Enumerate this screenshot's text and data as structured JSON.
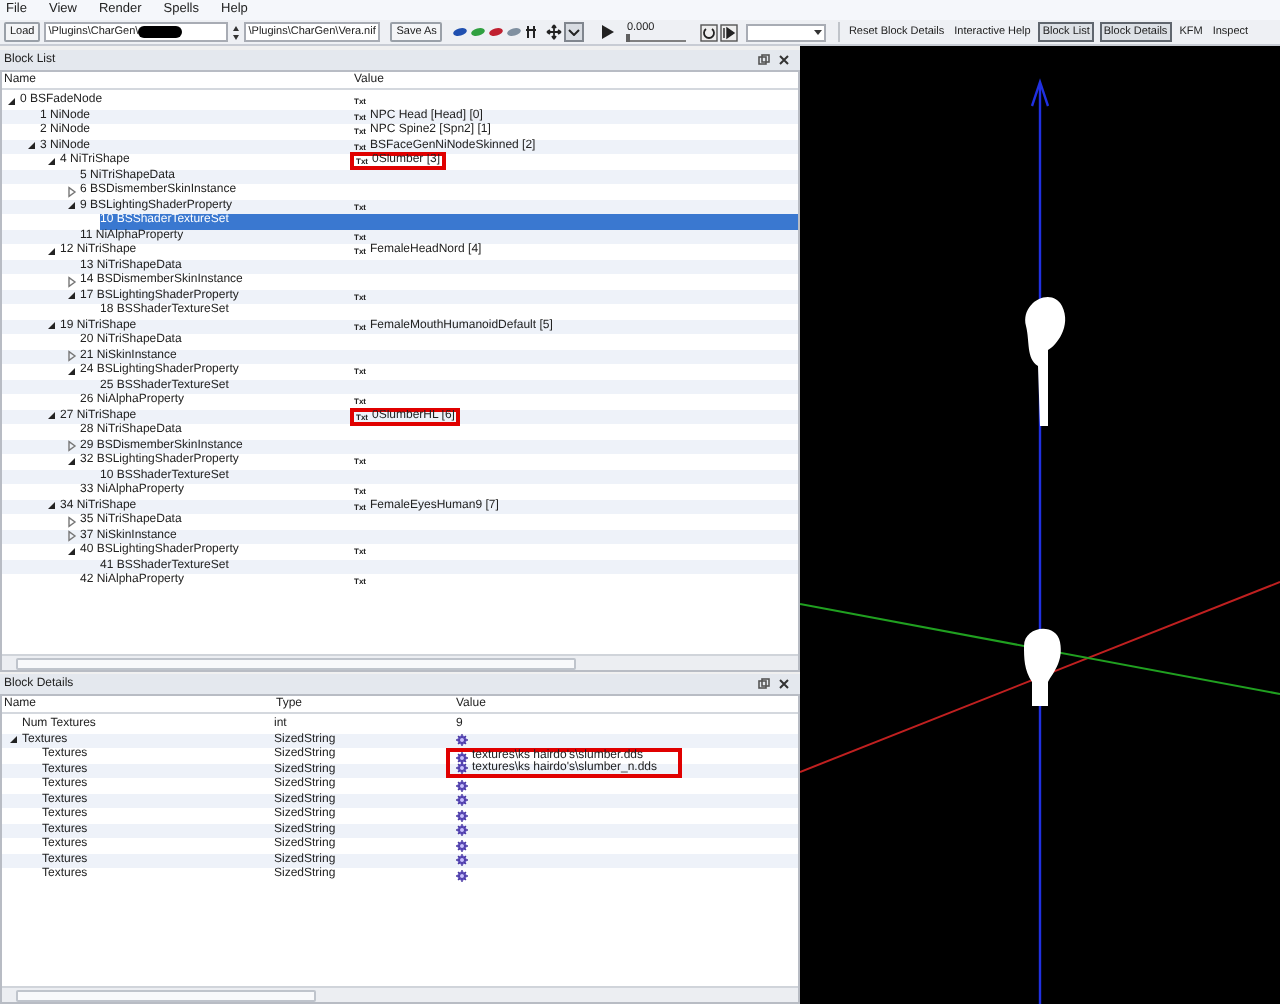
{
  "menu": [
    "File",
    "View",
    "Render",
    "Spells",
    "Help"
  ],
  "toolbar": {
    "load_button": "Load",
    "path_field": {
      "value": "\\Plugins\\CharGen\\",
      "redacted": true
    },
    "file_field": {
      "value": "\\Plugins\\CharGen\\Vera.nif"
    },
    "save_button": "Save As",
    "time": {
      "reading": "0.000",
      "level": 0
    },
    "buttons": [
      {
        "label": "Reset Block Details",
        "pressed": false
      },
      {
        "label": "Interactive Help",
        "pressed": false
      },
      {
        "label": "Block List",
        "pressed": true
      },
      {
        "label": "Block Details",
        "pressed": true
      },
      {
        "label": "KFM",
        "pressed": false
      },
      {
        "label": "Inspect",
        "pressed": false
      }
    ]
  },
  "block_list": {
    "title": "Block List",
    "columns": [
      "Name",
      "Value"
    ],
    "rows": [
      {
        "label": "0 BSFadeNode",
        "tag": "Txt",
        "expanded": true,
        "selected": false,
        "highlighted": false,
        "children": [
          {
            "label": "1 NiNode",
            "tag": "Txt",
            "value": "NPC Head [Head] [0]",
            "selected": false,
            "highlighted": false
          },
          {
            "label": "2 NiNode",
            "tag": "Txt",
            "value": "NPC Spine2 [Spn2] [1]",
            "selected": false,
            "highlighted": false
          },
          {
            "label": "3 NiNode",
            "tag": "Txt",
            "value": "BSFaceGenNiNodeSkinned [2]",
            "expanded": true,
            "selected": false,
            "highlighted": false,
            "children": [
              {
                "label": "4 NiTriShape",
                "tag": "Txt",
                "value": "0Slumber [3]",
                "expanded": true,
                "selected": false,
                "highlighted": true,
                "children": [
                  {
                    "label": "5 NiTriShapeData",
                    "selected": false,
                    "highlighted": false
                  },
                  {
                    "label": "6 BSDismemberSkinInstance",
                    "expanded": false,
                    "selected": false,
                    "highlighted": false
                  },
                  {
                    "label": "9 BSLightingShaderProperty",
                    "tag": "Txt",
                    "expanded": true,
                    "selected": false,
                    "highlighted": false,
                    "children": [
                      {
                        "label": "10 BSShaderTextureSet",
                        "selected": true,
                        "highlighted": false
                      }
                    ]
                  },
                  {
                    "label": "11 NiAlphaProperty",
                    "tag": "Txt",
                    "selected": false,
                    "highlighted": false
                  }
                ]
              },
              {
                "label": "12 NiTriShape",
                "tag": "Txt",
                "value": "FemaleHeadNord [4]",
                "expanded": true,
                "selected": false,
                "highlighted": false,
                "children": [
                  {
                    "label": "13 NiTriShapeData",
                    "selected": false,
                    "highlighted": false
                  },
                  {
                    "label": "14 BSDismemberSkinInstance",
                    "expanded": false,
                    "selected": false,
                    "highlighted": false
                  },
                  {
                    "label": "17 BSLightingShaderProperty",
                    "tag": "Txt",
                    "expanded": true,
                    "selected": false,
                    "highlighted": false,
                    "children": [
                      {
                        "label": "18 BSShaderTextureSet",
                        "selected": false,
                        "highlighted": false
                      }
                    ]
                  }
                ]
              },
              {
                "label": "19 NiTriShape",
                "tag": "Txt",
                "value": "FemaleMouthHumanoidDefault [5]",
                "expanded": true,
                "selected": false,
                "highlighted": false,
                "children": [
                  {
                    "label": "20 NiTriShapeData",
                    "selected": false,
                    "highlighted": false
                  },
                  {
                    "label": "21 NiSkinInstance",
                    "expanded": false,
                    "selected": false,
                    "highlighted": false
                  },
                  {
                    "label": "24 BSLightingShaderProperty",
                    "tag": "Txt",
                    "expanded": true,
                    "selected": false,
                    "highlighted": false,
                    "children": [
                      {
                        "label": "25 BSShaderTextureSet",
                        "selected": false,
                        "highlighted": false
                      }
                    ]
                  },
                  {
                    "label": "26 NiAlphaProperty",
                    "tag": "Txt",
                    "selected": false,
                    "highlighted": false
                  }
                ]
              },
              {
                "label": "27 NiTriShape",
                "tag": "Txt",
                "value": "0SlumberHL [6]",
                "expanded": true,
                "selected": false,
                "highlighted": true,
                "children": [
                  {
                    "label": "28 NiTriShapeData",
                    "selected": false,
                    "highlighted": false
                  },
                  {
                    "label": "29 BSDismemberSkinInstance",
                    "expanded": false,
                    "selected": false,
                    "highlighted": false
                  },
                  {
                    "label": "32 BSLightingShaderProperty",
                    "tag": "Txt",
                    "expanded": true,
                    "selected": false,
                    "highlighted": false,
                    "children": [
                      {
                        "label": "10 BSShaderTextureSet",
                        "selected": false,
                        "highlighted": false
                      }
                    ]
                  },
                  {
                    "label": "33 NiAlphaProperty",
                    "tag": "Txt",
                    "selected": false,
                    "highlighted": false
                  }
                ]
              },
              {
                "label": "34 NiTriShape",
                "tag": "Txt",
                "value": "FemaleEyesHuman9 [7]",
                "expanded": true,
                "selected": false,
                "highlighted": false,
                "children": [
                  {
                    "label": "35 NiTriShapeData",
                    "expanded": false,
                    "selected": false,
                    "highlighted": false
                  },
                  {
                    "label": "37 NiSkinInstance",
                    "expanded": false,
                    "selected": false,
                    "highlighted": false
                  },
                  {
                    "label": "40 BSLightingShaderProperty",
                    "tag": "Txt",
                    "expanded": true,
                    "selected": false,
                    "highlighted": false,
                    "children": [
                      {
                        "label": "41 BSShaderTextureSet",
                        "selected": false,
                        "highlighted": false
                      }
                    ]
                  },
                  {
                    "label": "42 NiAlphaProperty",
                    "tag": "Txt",
                    "selected": false,
                    "highlighted": false
                  }
                ]
              }
            ]
          }
        ]
      }
    ]
  },
  "block_details": {
    "title": "Block Details",
    "columns": [
      "Name",
      "Type",
      "Value"
    ],
    "rows": [
      {
        "name": "Num Textures",
        "type": "int",
        "value": "9",
        "highlighted": false
      },
      {
        "name": "Textures",
        "type": "SizedString",
        "value_icon": true,
        "expanded": true,
        "highlighted": false,
        "children": [
          {
            "name": "Textures",
            "type": "SizedString",
            "value_icon": true,
            "value": "textures\\ks hairdo's\\slumber.dds",
            "highlighted": true
          },
          {
            "name": "Textures",
            "type": "SizedString",
            "value_icon": true,
            "value": "textures\\ks hairdo's\\slumber_n.dds",
            "highlighted": true
          },
          {
            "name": "Textures",
            "type": "SizedString",
            "value_icon": true,
            "highlighted": false
          },
          {
            "name": "Textures",
            "type": "SizedString",
            "value_icon": true,
            "highlighted": false
          },
          {
            "name": "Textures",
            "type": "SizedString",
            "value_icon": true,
            "highlighted": false
          },
          {
            "name": "Textures",
            "type": "SizedString",
            "value_icon": true,
            "highlighted": false
          },
          {
            "name": "Textures",
            "type": "SizedString",
            "value_icon": true,
            "highlighted": false
          },
          {
            "name": "Textures",
            "type": "SizedString",
            "value_icon": true,
            "highlighted": false
          },
          {
            "name": "Textures",
            "type": "SizedString",
            "value_icon": true,
            "highlighted": false
          }
        ]
      }
    ]
  }
}
